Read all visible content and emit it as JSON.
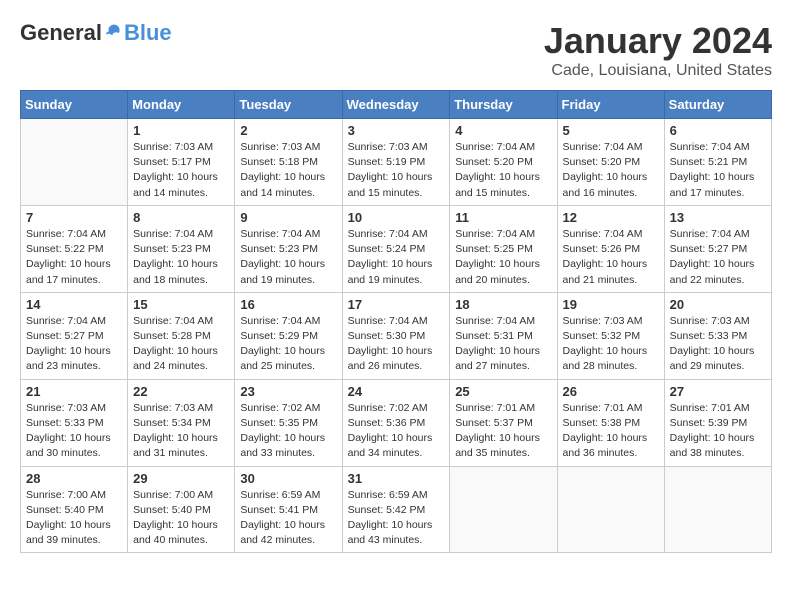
{
  "logo": {
    "general": "General",
    "blue": "Blue"
  },
  "title": "January 2024",
  "subtitle": "Cade, Louisiana, United States",
  "days_of_week": [
    "Sunday",
    "Monday",
    "Tuesday",
    "Wednesday",
    "Thursday",
    "Friday",
    "Saturday"
  ],
  "weeks": [
    [
      {
        "day": "",
        "info": ""
      },
      {
        "day": "1",
        "info": "Sunrise: 7:03 AM\nSunset: 5:17 PM\nDaylight: 10 hours\nand 14 minutes."
      },
      {
        "day": "2",
        "info": "Sunrise: 7:03 AM\nSunset: 5:18 PM\nDaylight: 10 hours\nand 14 minutes."
      },
      {
        "day": "3",
        "info": "Sunrise: 7:03 AM\nSunset: 5:19 PM\nDaylight: 10 hours\nand 15 minutes."
      },
      {
        "day": "4",
        "info": "Sunrise: 7:04 AM\nSunset: 5:20 PM\nDaylight: 10 hours\nand 15 minutes."
      },
      {
        "day": "5",
        "info": "Sunrise: 7:04 AM\nSunset: 5:20 PM\nDaylight: 10 hours\nand 16 minutes."
      },
      {
        "day": "6",
        "info": "Sunrise: 7:04 AM\nSunset: 5:21 PM\nDaylight: 10 hours\nand 17 minutes."
      }
    ],
    [
      {
        "day": "7",
        "info": "Sunrise: 7:04 AM\nSunset: 5:22 PM\nDaylight: 10 hours\nand 17 minutes."
      },
      {
        "day": "8",
        "info": "Sunrise: 7:04 AM\nSunset: 5:23 PM\nDaylight: 10 hours\nand 18 minutes."
      },
      {
        "day": "9",
        "info": "Sunrise: 7:04 AM\nSunset: 5:23 PM\nDaylight: 10 hours\nand 19 minutes."
      },
      {
        "day": "10",
        "info": "Sunrise: 7:04 AM\nSunset: 5:24 PM\nDaylight: 10 hours\nand 19 minutes."
      },
      {
        "day": "11",
        "info": "Sunrise: 7:04 AM\nSunset: 5:25 PM\nDaylight: 10 hours\nand 20 minutes."
      },
      {
        "day": "12",
        "info": "Sunrise: 7:04 AM\nSunset: 5:26 PM\nDaylight: 10 hours\nand 21 minutes."
      },
      {
        "day": "13",
        "info": "Sunrise: 7:04 AM\nSunset: 5:27 PM\nDaylight: 10 hours\nand 22 minutes."
      }
    ],
    [
      {
        "day": "14",
        "info": "Sunrise: 7:04 AM\nSunset: 5:27 PM\nDaylight: 10 hours\nand 23 minutes."
      },
      {
        "day": "15",
        "info": "Sunrise: 7:04 AM\nSunset: 5:28 PM\nDaylight: 10 hours\nand 24 minutes."
      },
      {
        "day": "16",
        "info": "Sunrise: 7:04 AM\nSunset: 5:29 PM\nDaylight: 10 hours\nand 25 minutes."
      },
      {
        "day": "17",
        "info": "Sunrise: 7:04 AM\nSunset: 5:30 PM\nDaylight: 10 hours\nand 26 minutes."
      },
      {
        "day": "18",
        "info": "Sunrise: 7:04 AM\nSunset: 5:31 PM\nDaylight: 10 hours\nand 27 minutes."
      },
      {
        "day": "19",
        "info": "Sunrise: 7:03 AM\nSunset: 5:32 PM\nDaylight: 10 hours\nand 28 minutes."
      },
      {
        "day": "20",
        "info": "Sunrise: 7:03 AM\nSunset: 5:33 PM\nDaylight: 10 hours\nand 29 minutes."
      }
    ],
    [
      {
        "day": "21",
        "info": "Sunrise: 7:03 AM\nSunset: 5:33 PM\nDaylight: 10 hours\nand 30 minutes."
      },
      {
        "day": "22",
        "info": "Sunrise: 7:03 AM\nSunset: 5:34 PM\nDaylight: 10 hours\nand 31 minutes."
      },
      {
        "day": "23",
        "info": "Sunrise: 7:02 AM\nSunset: 5:35 PM\nDaylight: 10 hours\nand 33 minutes."
      },
      {
        "day": "24",
        "info": "Sunrise: 7:02 AM\nSunset: 5:36 PM\nDaylight: 10 hours\nand 34 minutes."
      },
      {
        "day": "25",
        "info": "Sunrise: 7:01 AM\nSunset: 5:37 PM\nDaylight: 10 hours\nand 35 minutes."
      },
      {
        "day": "26",
        "info": "Sunrise: 7:01 AM\nSunset: 5:38 PM\nDaylight: 10 hours\nand 36 minutes."
      },
      {
        "day": "27",
        "info": "Sunrise: 7:01 AM\nSunset: 5:39 PM\nDaylight: 10 hours\nand 38 minutes."
      }
    ],
    [
      {
        "day": "28",
        "info": "Sunrise: 7:00 AM\nSunset: 5:40 PM\nDaylight: 10 hours\nand 39 minutes."
      },
      {
        "day": "29",
        "info": "Sunrise: 7:00 AM\nSunset: 5:40 PM\nDaylight: 10 hours\nand 40 minutes."
      },
      {
        "day": "30",
        "info": "Sunrise: 6:59 AM\nSunset: 5:41 PM\nDaylight: 10 hours\nand 42 minutes."
      },
      {
        "day": "31",
        "info": "Sunrise: 6:59 AM\nSunset: 5:42 PM\nDaylight: 10 hours\nand 43 minutes."
      },
      {
        "day": "",
        "info": ""
      },
      {
        "day": "",
        "info": ""
      },
      {
        "day": "",
        "info": ""
      }
    ]
  ]
}
